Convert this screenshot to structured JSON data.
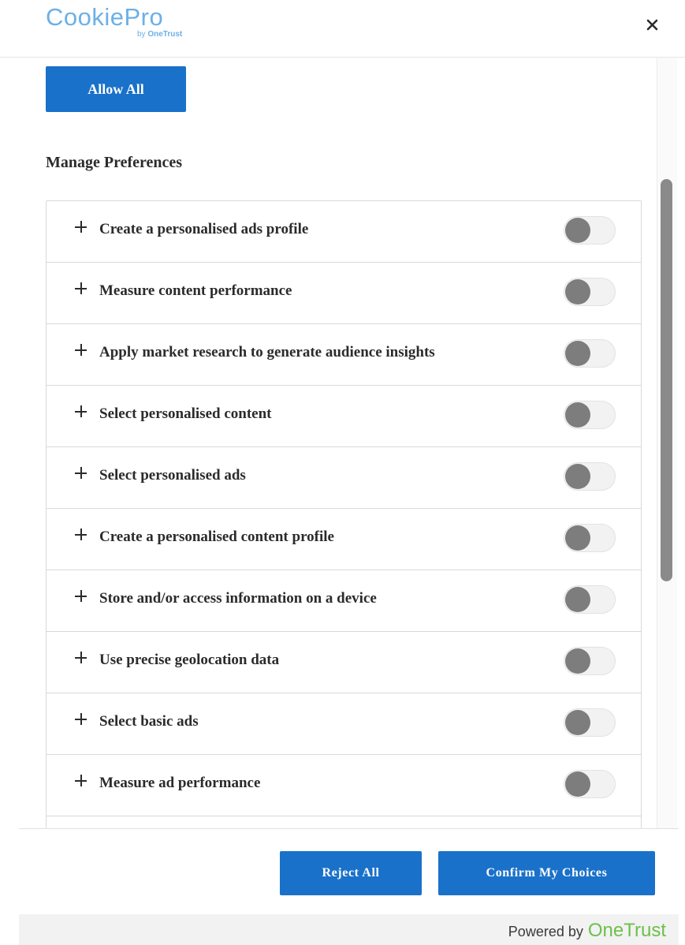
{
  "header": {
    "logo_main": "CookiePro",
    "logo_sub_prefix": "by",
    "logo_sub_brand": "OneTrust"
  },
  "actions": {
    "allow_all_label": "Allow All",
    "reject_all_label": "Reject All",
    "confirm_label": "Confirm My Choices"
  },
  "preferences": {
    "title": "Manage Preferences",
    "items": [
      {
        "label": "Create a personalised ads profile",
        "enabled": false
      },
      {
        "label": "Measure content performance",
        "enabled": false
      },
      {
        "label": "Apply market research to generate audience insights",
        "enabled": false
      },
      {
        "label": "Select personalised content",
        "enabled": false
      },
      {
        "label": "Select personalised ads",
        "enabled": false
      },
      {
        "label": "Create a personalised content profile",
        "enabled": false
      },
      {
        "label": "Store and/or access information on a device",
        "enabled": false
      },
      {
        "label": "Use precise geolocation data",
        "enabled": false
      },
      {
        "label": "Select basic ads",
        "enabled": false
      },
      {
        "label": "Measure ad performance",
        "enabled": false
      }
    ]
  },
  "footer": {
    "powered_by": "Powered by",
    "powered_brand": "OneTrust"
  },
  "colors": {
    "primary_button": "#1a71c9",
    "logo": "#6cb0e6",
    "onetrust_brand": "#6cc04a",
    "toggle_off_knob": "#7d7d7d"
  },
  "icons": {
    "close": "close-icon",
    "expand": "plus-icon"
  }
}
